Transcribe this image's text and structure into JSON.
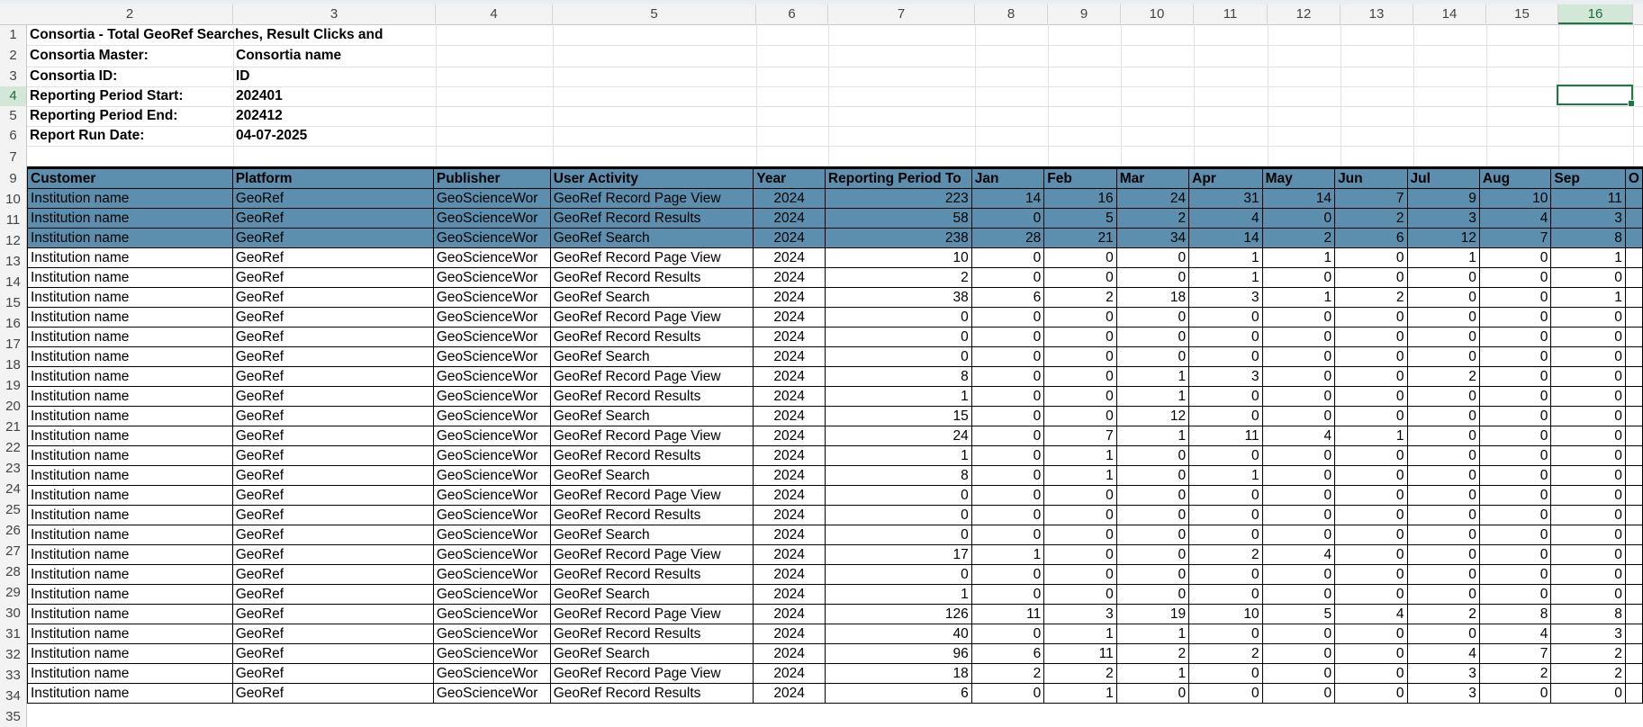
{
  "column_headers": [
    "2",
    "3",
    "4",
    "5",
    "6",
    "7",
    "8",
    "9",
    "10",
    "11",
    "12",
    "13",
    "14",
    "15",
    "16"
  ],
  "selected_column": "16",
  "row_headers": [
    "1",
    "2",
    "3",
    "4",
    "5",
    "6",
    "7",
    "9",
    "10",
    "11",
    "12",
    "13",
    "14",
    "15",
    "16",
    "17",
    "18",
    "19",
    "20",
    "21",
    "22",
    "23",
    "24",
    "25",
    "26",
    "27",
    "28",
    "29",
    "30",
    "31",
    "32",
    "33",
    "34",
    "35"
  ],
  "header_block": {
    "title": "Consortia - Total GeoRef Searches, Result Clicks and",
    "master_label": "Consortia Master:",
    "master_value": "Consortia name",
    "id_label": "Consortia ID:",
    "id_value": "ID",
    "start_label": "Reporting Period Start:",
    "start_value": "202401",
    "end_label": "Reporting Period End:",
    "end_value": "202412",
    "run_label": "Report Run Date:",
    "run_value": "04-07-2025"
  },
  "table": {
    "headers": [
      "Customer",
      "Platform",
      "Publisher",
      "User Activity",
      "Year",
      "Reporting Period To",
      "Jan",
      "Feb",
      "Mar",
      "Apr",
      "May",
      "Jun",
      "Jul",
      "Aug",
      "Sep",
      "O"
    ],
    "rows": [
      [
        "Institution name",
        "GeoRef",
        "GeoScienceWor",
        "GeoRef Record Page View",
        "2024",
        "223",
        "14",
        "16",
        "24",
        "31",
        "14",
        "7",
        "9",
        "10",
        "11"
      ],
      [
        "Institution name",
        "GeoRef",
        "GeoScienceWor",
        "GeoRef Record Results",
        "2024",
        "58",
        "0",
        "5",
        "2",
        "4",
        "0",
        "2",
        "3",
        "4",
        "3"
      ],
      [
        "Institution name",
        "GeoRef",
        "GeoScienceWor",
        "GeoRef Search",
        "2024",
        "238",
        "28",
        "21",
        "34",
        "14",
        "2",
        "6",
        "12",
        "7",
        "8"
      ],
      [
        "Institution name",
        "GeoRef",
        "GeoScienceWor",
        "GeoRef Record Page View",
        "2024",
        "10",
        "0",
        "0",
        "0",
        "1",
        "1",
        "0",
        "1",
        "0",
        "1"
      ],
      [
        "Institution name",
        "GeoRef",
        "GeoScienceWor",
        "GeoRef Record Results",
        "2024",
        "2",
        "0",
        "0",
        "0",
        "1",
        "0",
        "0",
        "0",
        "0",
        "0"
      ],
      [
        "Institution name",
        "GeoRef",
        "GeoScienceWor",
        "GeoRef Search",
        "2024",
        "38",
        "6",
        "2",
        "18",
        "3",
        "1",
        "2",
        "0",
        "0",
        "1"
      ],
      [
        "Institution name",
        "GeoRef",
        "GeoScienceWor",
        "GeoRef Record Page View",
        "2024",
        "0",
        "0",
        "0",
        "0",
        "0",
        "0",
        "0",
        "0",
        "0",
        "0"
      ],
      [
        "Institution name",
        "GeoRef",
        "GeoScienceWor",
        "GeoRef Record Results",
        "2024",
        "0",
        "0",
        "0",
        "0",
        "0",
        "0",
        "0",
        "0",
        "0",
        "0"
      ],
      [
        "Institution name",
        "GeoRef",
        "GeoScienceWor",
        "GeoRef Search",
        "2024",
        "0",
        "0",
        "0",
        "0",
        "0",
        "0",
        "0",
        "0",
        "0",
        "0"
      ],
      [
        "Institution name",
        "GeoRef",
        "GeoScienceWor",
        "GeoRef Record Page View",
        "2024",
        "8",
        "0",
        "0",
        "1",
        "3",
        "0",
        "0",
        "2",
        "0",
        "0"
      ],
      [
        "Institution name",
        "GeoRef",
        "GeoScienceWor",
        "GeoRef Record Results",
        "2024",
        "1",
        "0",
        "0",
        "1",
        "0",
        "0",
        "0",
        "0",
        "0",
        "0"
      ],
      [
        "Institution name",
        "GeoRef",
        "GeoScienceWor",
        "GeoRef Search",
        "2024",
        "15",
        "0",
        "0",
        "12",
        "0",
        "0",
        "0",
        "0",
        "0",
        "0"
      ],
      [
        "Institution name",
        "GeoRef",
        "GeoScienceWor",
        "GeoRef Record Page View",
        "2024",
        "24",
        "0",
        "7",
        "1",
        "11",
        "4",
        "1",
        "0",
        "0",
        "0"
      ],
      [
        "Institution name",
        "GeoRef",
        "GeoScienceWor",
        "GeoRef Record Results",
        "2024",
        "1",
        "0",
        "1",
        "0",
        "0",
        "0",
        "0",
        "0",
        "0",
        "0"
      ],
      [
        "Institution name",
        "GeoRef",
        "GeoScienceWor",
        "GeoRef Search",
        "2024",
        "8",
        "0",
        "1",
        "0",
        "1",
        "0",
        "0",
        "0",
        "0",
        "0"
      ],
      [
        "Institution name",
        "GeoRef",
        "GeoScienceWor",
        "GeoRef Record Page View",
        "2024",
        "0",
        "0",
        "0",
        "0",
        "0",
        "0",
        "0",
        "0",
        "0",
        "0"
      ],
      [
        "Institution name",
        "GeoRef",
        "GeoScienceWor",
        "GeoRef Record Results",
        "2024",
        "0",
        "0",
        "0",
        "0",
        "0",
        "0",
        "0",
        "0",
        "0",
        "0"
      ],
      [
        "Institution name",
        "GeoRef",
        "GeoScienceWor",
        "GeoRef Search",
        "2024",
        "0",
        "0",
        "0",
        "0",
        "0",
        "0",
        "0",
        "0",
        "0",
        "0"
      ],
      [
        "Institution name",
        "GeoRef",
        "GeoScienceWor",
        "GeoRef Record Page View",
        "2024",
        "17",
        "1",
        "0",
        "0",
        "2",
        "4",
        "0",
        "0",
        "0",
        "0"
      ],
      [
        "Institution name",
        "GeoRef",
        "GeoScienceWor",
        "GeoRef Record Results",
        "2024",
        "0",
        "0",
        "0",
        "0",
        "0",
        "0",
        "0",
        "0",
        "0",
        "0"
      ],
      [
        "Institution name",
        "GeoRef",
        "GeoScienceWor",
        "GeoRef Search",
        "2024",
        "1",
        "0",
        "0",
        "0",
        "0",
        "0",
        "0",
        "0",
        "0",
        "0"
      ],
      [
        "Institution name",
        "GeoRef",
        "GeoScienceWor",
        "GeoRef Record Page View",
        "2024",
        "126",
        "11",
        "3",
        "19",
        "10",
        "5",
        "4",
        "2",
        "8",
        "8"
      ],
      [
        "Institution name",
        "GeoRef",
        "GeoScienceWor",
        "GeoRef Record Results",
        "2024",
        "40",
        "0",
        "1",
        "1",
        "0",
        "0",
        "0",
        "0",
        "4",
        "3"
      ],
      [
        "Institution name",
        "GeoRef",
        "GeoScienceWor",
        "GeoRef Search",
        "2024",
        "96",
        "6",
        "11",
        "2",
        "2",
        "0",
        "0",
        "4",
        "7",
        "2"
      ],
      [
        "Institution name",
        "GeoRef",
        "GeoScienceWor",
        "GeoRef Record Page View",
        "2024",
        "18",
        "2",
        "2",
        "1",
        "0",
        "0",
        "0",
        "3",
        "2",
        "2"
      ],
      [
        "Institution name",
        "GeoRef",
        "GeoScienceWor",
        "GeoRef Record Results",
        "2024",
        "6",
        "0",
        "1",
        "0",
        "0",
        "0",
        "0",
        "3",
        "0",
        "0"
      ]
    ],
    "highlighted_rows": 3
  },
  "colors": {
    "header_fill": "#5c8fae",
    "selection": "#1e7a45"
  }
}
